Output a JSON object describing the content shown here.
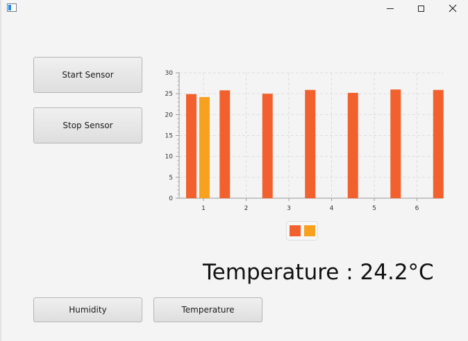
{
  "window": {
    "title": ""
  },
  "buttons": {
    "start": "Start Sensor",
    "stop": "Stop Sensor",
    "humidity": "Humidity",
    "temperature": "Temperature"
  },
  "readout": {
    "label": "Temperature : ",
    "value": "24.2°C"
  },
  "colors": {
    "series1": "#f2612d",
    "series2": "#f8a11f"
  },
  "chart_data": {
    "type": "bar",
    "categories": [
      "1",
      "2",
      "3",
      "4",
      "5",
      "6"
    ],
    "series": [
      {
        "values": [
          24.9,
          25.8,
          25.0,
          25.9,
          25.2,
          26.0,
          25.9
        ],
        "x": [
          1,
          1.5,
          2.5,
          3.5,
          4.5,
          5.5,
          6.5
        ]
      },
      {
        "values": [
          24.2
        ],
        "x": [
          1
        ]
      }
    ],
    "ylim": [
      0,
      30
    ],
    "yticks": [
      "0",
      "5",
      "10",
      "15",
      "20",
      "25",
      "30"
    ],
    "grid": true,
    "legend": "bottom",
    "xlabel": "",
    "ylabel": "",
    "title": ""
  }
}
